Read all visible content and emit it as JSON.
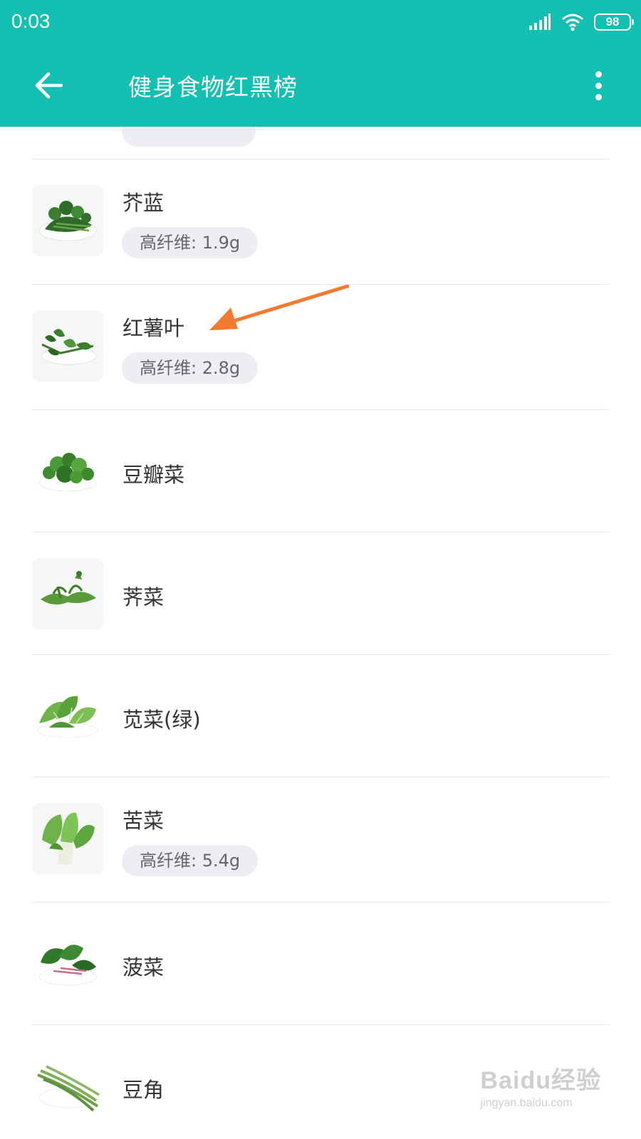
{
  "status_bar": {
    "time": "0:03",
    "battery": "98",
    "signal_icon": "cellular-signal-icon",
    "wifi_icon": "wifi-icon"
  },
  "app_bar": {
    "title": "健身食物红黑榜",
    "back_icon": "arrow-left-icon",
    "menu_icon": "more-vertical-icon",
    "color": "#13BFB0"
  },
  "items": [
    {
      "name": "芥蓝",
      "tag": "高纤维: 1.9g"
    },
    {
      "name": "红薯叶",
      "tag": "高纤维: 2.8g"
    },
    {
      "name": "豆瓣菜"
    },
    {
      "name": "荠菜"
    },
    {
      "name": "苋菜(绿)"
    },
    {
      "name": "苦菜",
      "tag": "高纤维: 5.4g"
    },
    {
      "name": "菠菜"
    },
    {
      "name": "豆角"
    }
  ],
  "annotation": {
    "arrow_color": "#F47A32"
  },
  "watermark": {
    "logo": "Baidu经验",
    "url": "jingyan.baidu.com"
  }
}
